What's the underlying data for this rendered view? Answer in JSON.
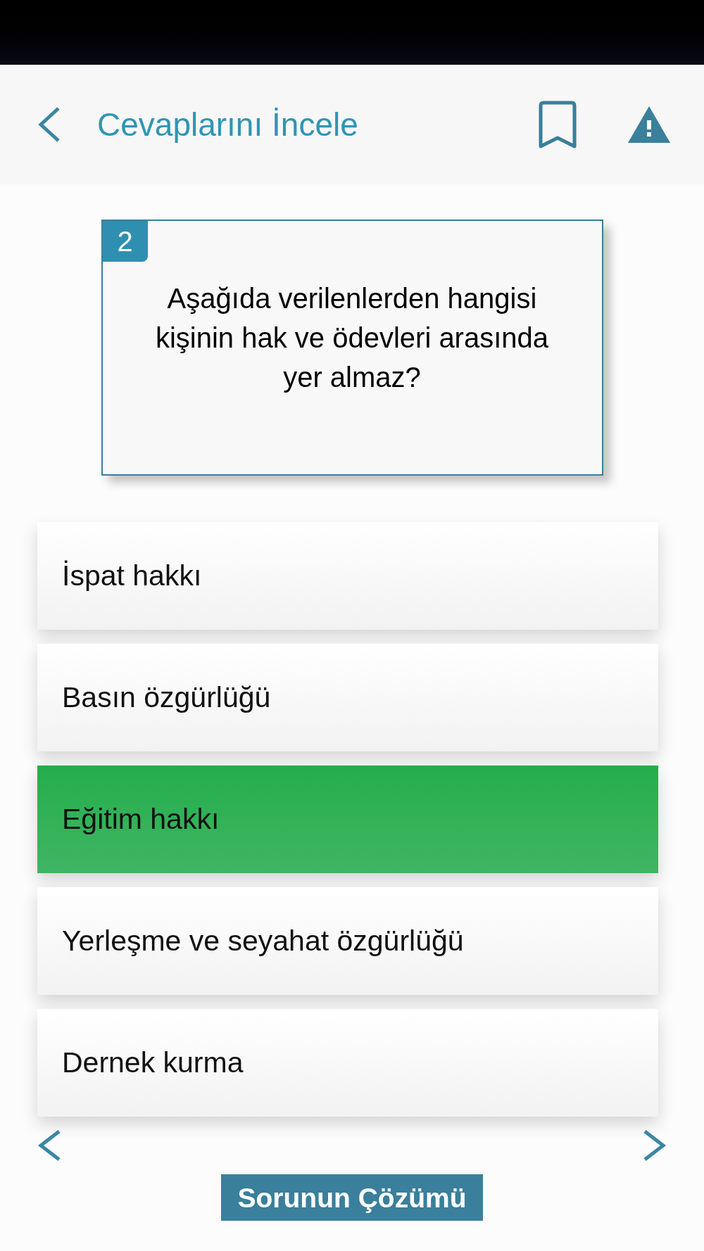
{
  "header": {
    "title": "Cevaplarını İncele"
  },
  "question": {
    "number": "2",
    "text": "Aşağıda verilenlerden hangisi kişinin hak ve ödevleri arasında yer almaz?"
  },
  "options": [
    {
      "text": "İspat hakkı",
      "correct": false
    },
    {
      "text": "Basın özgürlüğü",
      "correct": false
    },
    {
      "text": "Eğitim hakkı",
      "correct": true
    },
    {
      "text": "Yerleşme ve seyahat özgürlüğü",
      "correct": false
    },
    {
      "text": "Dernek kurma",
      "correct": false
    }
  ],
  "solution_button": {
    "label": "Sorunun Çözümü"
  }
}
